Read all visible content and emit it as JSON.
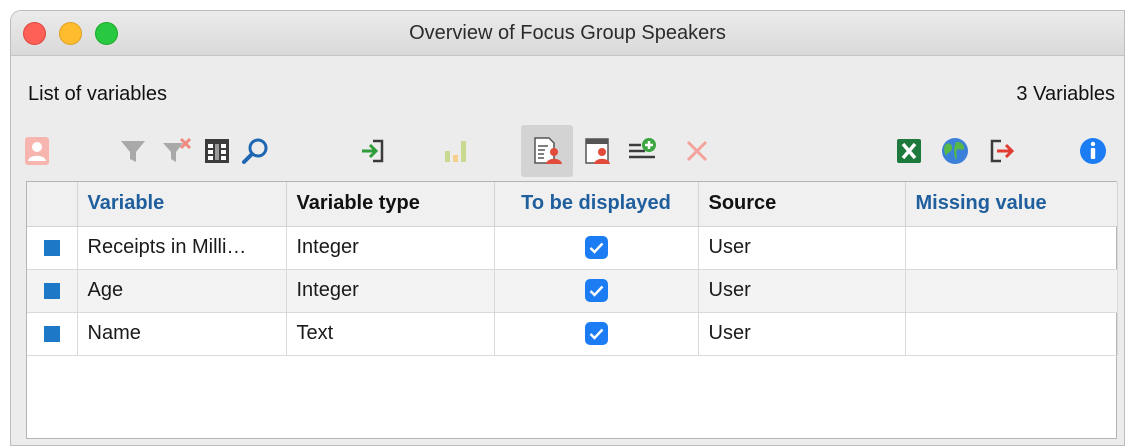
{
  "window": {
    "title": "Overview of Focus Group Speakers"
  },
  "header": {
    "subtitle": "List of variables",
    "count": "3 Variables"
  },
  "toolbar": {
    "buttons": [
      {
        "icon": "speaker-card-icon",
        "enabled": false
      },
      {
        "icon": "filter-icon",
        "enabled": false
      },
      {
        "icon": "remove-filter-icon",
        "enabled": false
      },
      {
        "icon": "columns-icon",
        "enabled": true
      },
      {
        "icon": "search-icon",
        "enabled": true
      },
      {
        "icon": "import-icon",
        "enabled": true
      },
      {
        "icon": "bar-chart-icon",
        "enabled": false
      },
      {
        "icon": "speaker-list-icon",
        "enabled": true,
        "active": true
      },
      {
        "icon": "speaker-window-icon",
        "enabled": true
      },
      {
        "icon": "add-variable-icon",
        "enabled": true
      },
      {
        "icon": "delete-icon",
        "enabled": false
      },
      {
        "icon": "excel-export-icon",
        "enabled": true
      },
      {
        "icon": "globe-export-icon",
        "enabled": true
      },
      {
        "icon": "export-icon",
        "enabled": true
      },
      {
        "icon": "info-icon",
        "enabled": true
      }
    ]
  },
  "table": {
    "columns": [
      "Variable",
      "Variable type",
      "To be displayed",
      "Source",
      "Missing value"
    ],
    "rows": [
      {
        "variable": "Receipts in Milli…",
        "type": "Integer",
        "displayed": true,
        "source": "User",
        "missing": ""
      },
      {
        "variable": "Age",
        "type": "Integer",
        "displayed": true,
        "source": "User",
        "missing": ""
      },
      {
        "variable": "Name",
        "type": "Text",
        "displayed": true,
        "source": "User",
        "missing": ""
      }
    ]
  },
  "colors": {
    "accent_blue": "#1c7cf4",
    "row_marker": "#1e78c8",
    "header_blue_text": "#1f5f9e",
    "delete_red": "#f3a39c",
    "excel_green": "#1e7a3c"
  }
}
